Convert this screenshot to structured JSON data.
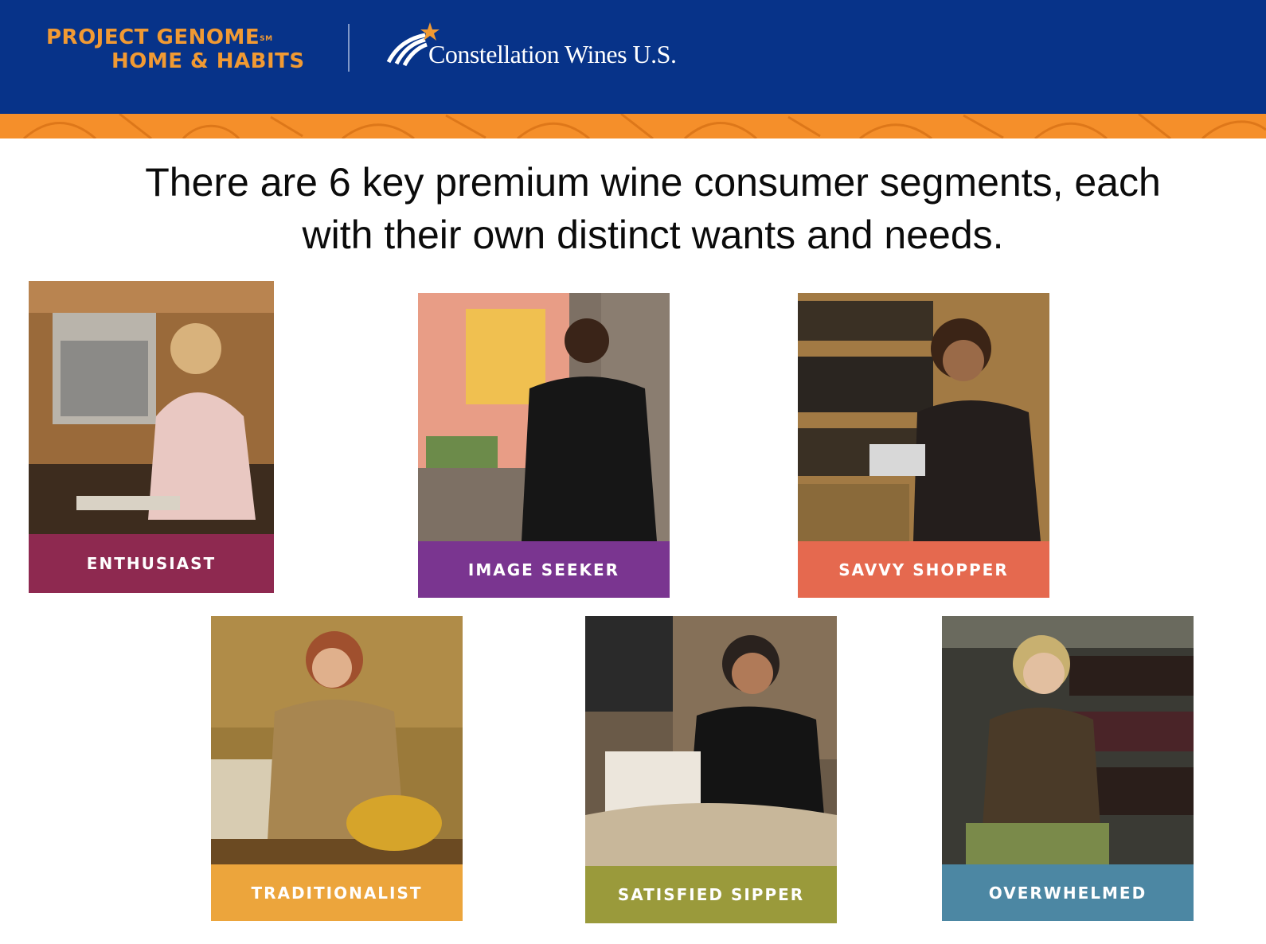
{
  "header": {
    "brand_line1": "PROJECT GENOME",
    "brand_sm": "SM",
    "brand_line2": "HOME & HABITS",
    "company": "Constellation Wines U.S.",
    "bg_color": "#073389",
    "band_color": "#f58f2a",
    "brand_color": "#f19a33"
  },
  "headline": {
    "line1": "There are 6 key premium wine consumer segments, each",
    "line2": "with their own distinct wants and needs."
  },
  "segments": [
    {
      "label": "ENTHUSIAST",
      "color": "#8e2950"
    },
    {
      "label": "IMAGE SEEKER",
      "color": "#7a3590"
    },
    {
      "label": "SAVVY SHOPPER",
      "color": "#e5694f"
    },
    {
      "label": "TRADITIONALIST",
      "color": "#eca53c"
    },
    {
      "label": "SATISFIED SIPPER",
      "color": "#9a9a3b"
    },
    {
      "label": "OVERWHELMED",
      "color": "#4c87a3"
    }
  ]
}
